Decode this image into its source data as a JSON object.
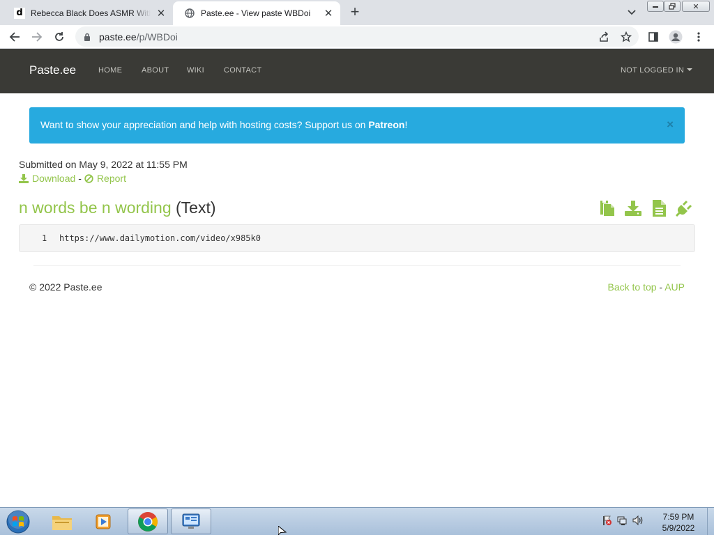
{
  "browser": {
    "tabs": [
      {
        "favicon": "d",
        "title": "Rebecca Black Does ASMR With I"
      },
      {
        "favicon": "globe-icon",
        "title": "Paste.ee - View paste WBDoi"
      }
    ],
    "url_host": "paste.ee",
    "url_path": "/p/WBDoi"
  },
  "site": {
    "brand": "Paste.ee",
    "nav": {
      "home": "HOME",
      "about": "ABOUT",
      "wiki": "WIKI",
      "contact": "CONTACT",
      "login": "NOT LOGGED IN"
    }
  },
  "alert": {
    "text": "Want to show your appreciation and help with hosting costs? Support us on ",
    "link": "Patreon",
    "suffix": "!",
    "close": "×"
  },
  "paste": {
    "submitted": "Submitted on May 9, 2022 at 11:55 PM",
    "download": "Download",
    "separator": "-",
    "report": "Report",
    "title": "n words be n wording",
    "language": "(Text)",
    "lines": [
      {
        "number": "1",
        "code": "https://www.dailymotion.com/video/x985k0"
      }
    ]
  },
  "footer": {
    "copyright": "© 2022 Paste.ee",
    "back_to_top": "Back to top",
    "separator": " - ",
    "aup": "AUP"
  },
  "taskbar": {
    "time": "7:59 PM",
    "date": "5/9/2022"
  },
  "colors": {
    "accent_green": "#93c54b",
    "navbar": "#3a3a36",
    "alert_blue": "#27aadf"
  }
}
